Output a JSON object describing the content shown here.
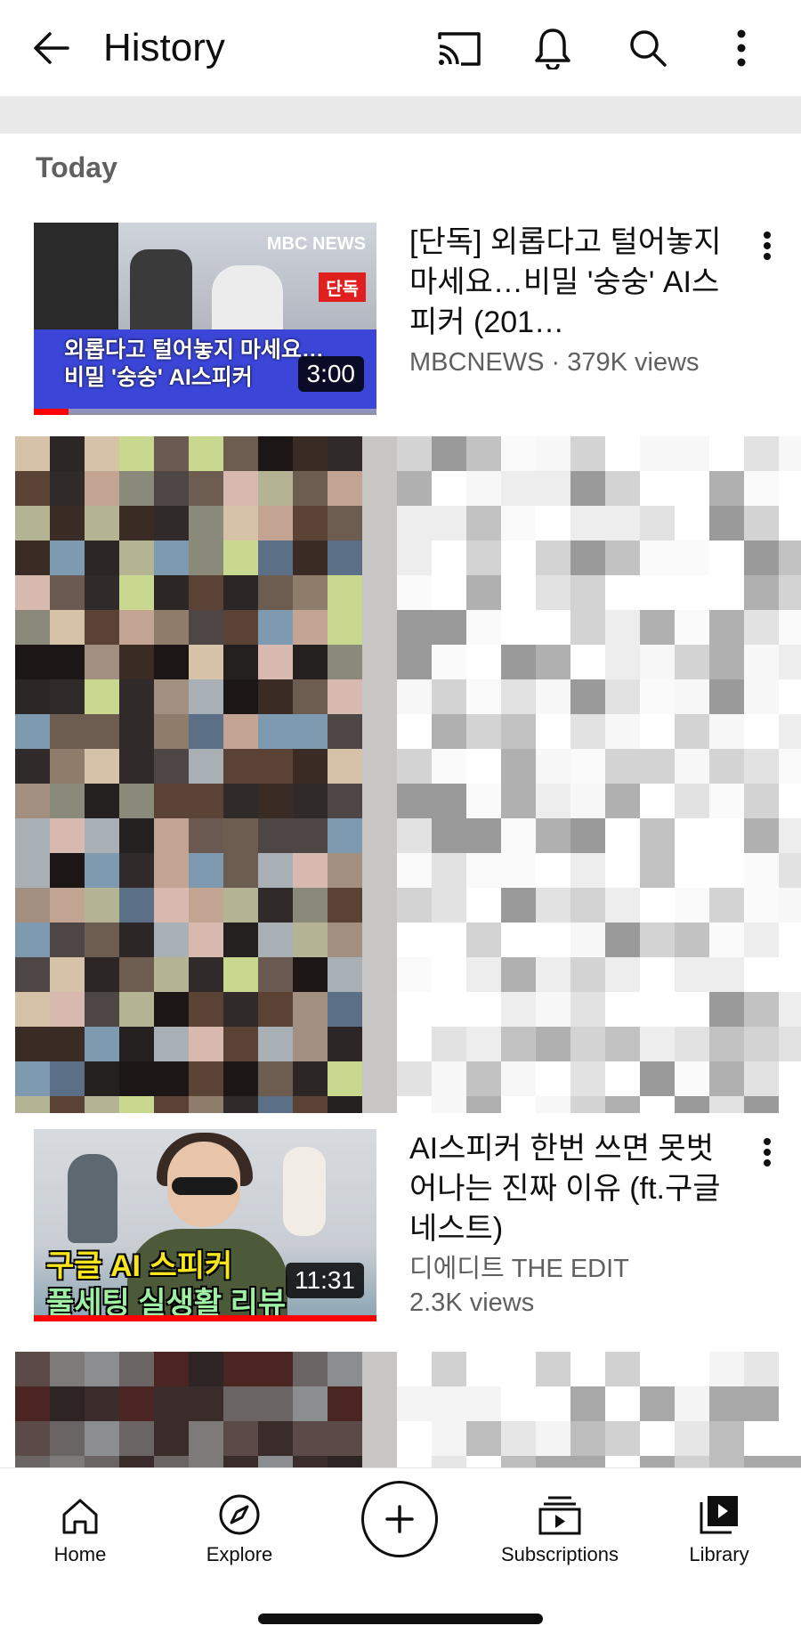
{
  "header": {
    "title": "History",
    "back_icon": "arrow-left-icon",
    "actions": [
      {
        "name": "cast",
        "icon": "cast-icon"
      },
      {
        "name": "notifications",
        "icon": "bell-icon"
      },
      {
        "name": "search",
        "icon": "search-icon"
      },
      {
        "name": "more",
        "icon": "more-vertical-icon"
      }
    ]
  },
  "section": {
    "title": "Today"
  },
  "videos": [
    {
      "title": "[단독] 외롭다고 털어놓지 마세요…비밀 '숭숭' AI스피커 (201…",
      "channel_views": "MBCNEWS · 379K views",
      "duration": "3:00",
      "thumb_caption_line1": "외롭다고 털어놓지 마세요…",
      "thumb_caption_line2": "비밀 '숭숭' AI스피커",
      "thumb_logo": "MBC NEWS",
      "thumb_badge": "단독",
      "watched_fraction": 0.1
    },
    {
      "title": "AI스피커 한번 쓰면 못벗어나는 진짜 이유 (ft.구글 네스트)",
      "channel": "디에디트 THE EDIT",
      "views": "2.3K views",
      "duration": "11:31",
      "thumb_caption_line1": "구글 AI 스피커",
      "thumb_caption_line2": "풀세팅 실생활 리뷰",
      "watched_fraction": 1.0
    }
  ],
  "bottom_nav": [
    {
      "label": "Home",
      "icon": "home-icon"
    },
    {
      "label": "Explore",
      "icon": "compass-icon"
    },
    {
      "label": "",
      "icon": "create-plus-icon"
    },
    {
      "label": "Subscriptions",
      "icon": "subscriptions-icon"
    },
    {
      "label": "Library",
      "icon": "library-icon"
    }
  ],
  "colors": {
    "accent_red": "#ff0000",
    "text_primary": "#0f0f0f",
    "text_secondary": "#606060"
  }
}
